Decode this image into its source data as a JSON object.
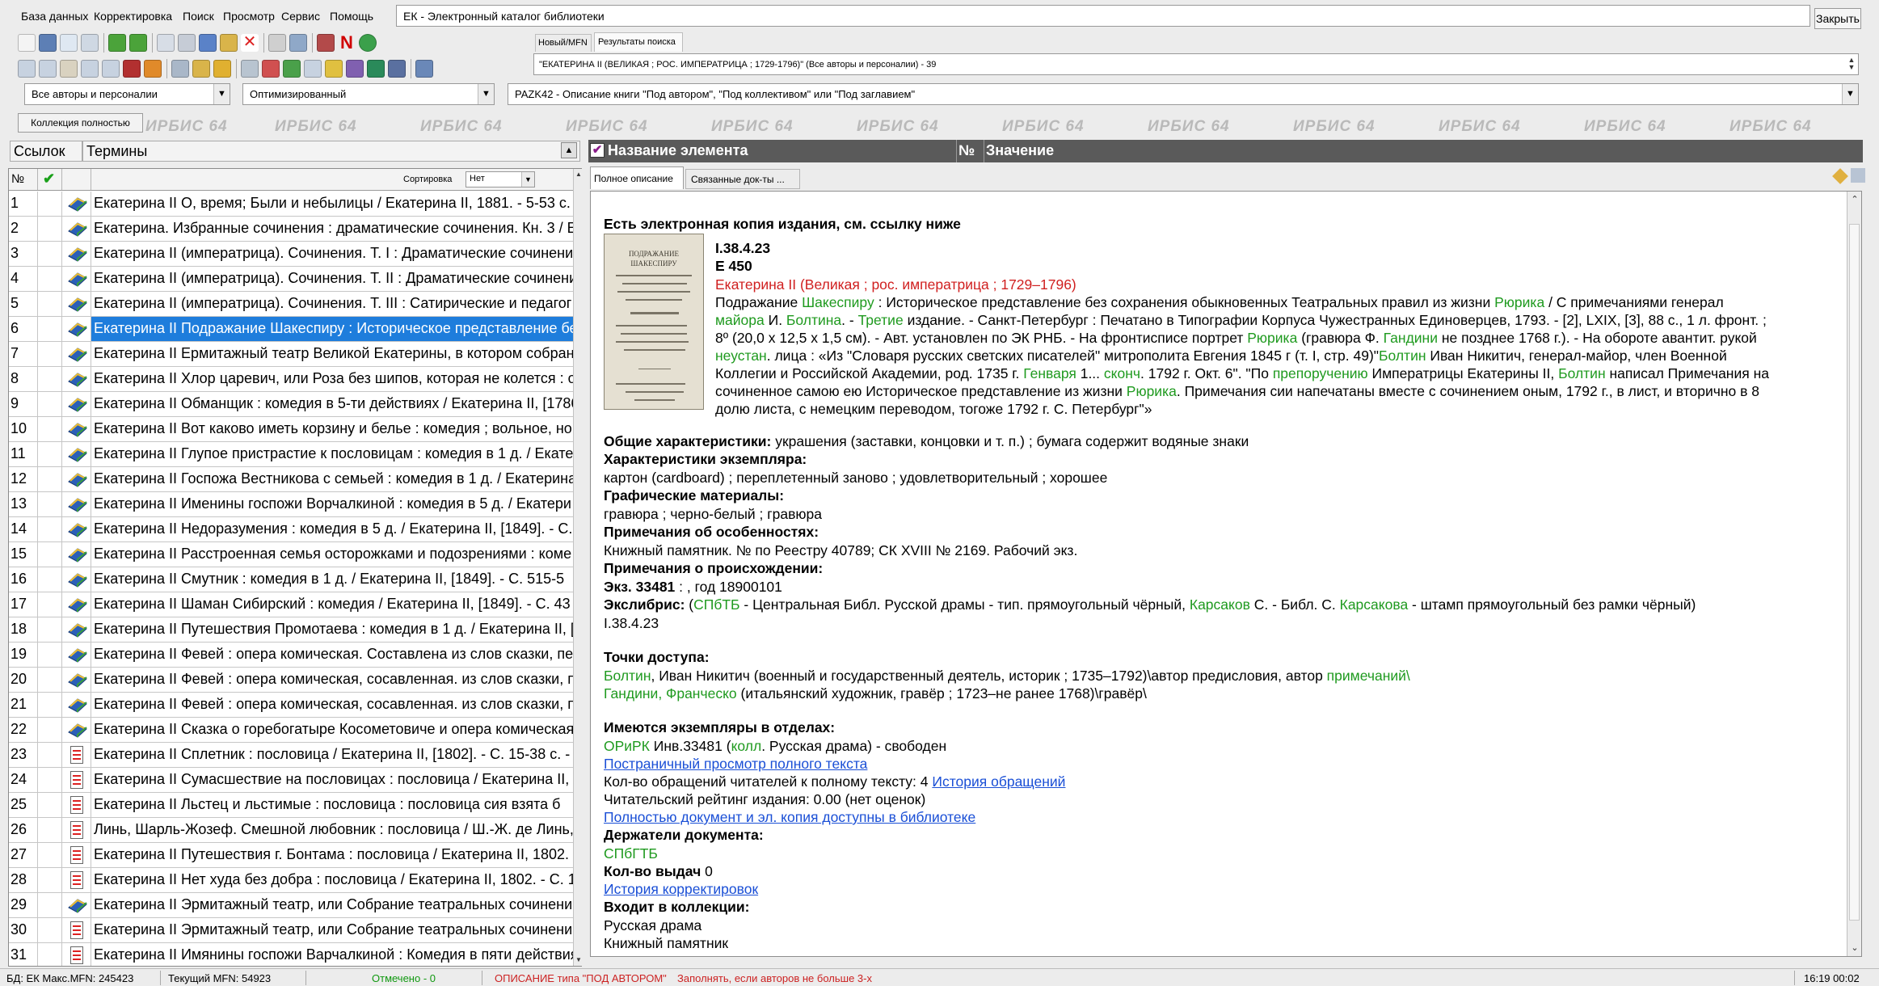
{
  "menu": [
    "База данных",
    "Корректировка",
    "Поиск",
    "Просмотр",
    "Сервис",
    "Помощь"
  ],
  "window_title": "ЕК - Электронный каталог библиотеки",
  "close_label": "Закрыть",
  "tabs": {
    "new_mfn": "Новый/MFN",
    "results": "Результаты поиска"
  },
  "query": "\"ЕКАТЕРИНА II (ВЕЛИКАЯ ; РОС. ИМПЕРАТРИЦА ; 1729-1796)\" (Все авторы и персоналии) - 39",
  "combos": {
    "authors": "Все авторы и персоналии",
    "optimized": "Оптимизированный",
    "worksheet": "PAZK42 - Описание книги \"Под автором\", \"Под коллективом\" или \"Под заглавием\""
  },
  "collection_button": "Коллекция полностью",
  "watermark": "ИРБИС 64",
  "left_panel": {
    "col_ssylok": "Ссылок",
    "col_terms": "Термины",
    "col_no": "№",
    "sort_label": "Сортировка",
    "sort_value": "Нет"
  },
  "rows": [
    {
      "n": "1",
      "icon": "book",
      "text": "Екатерина II О, время; Были и небылицы / Екатерина II, 1881. - 5-53 с."
    },
    {
      "n": "2",
      "icon": "book",
      "text": "Екатерина. Избранные сочинения : драматические сочинения. Кн. 3 / Ек"
    },
    {
      "n": "3",
      "icon": "book",
      "text": "Екатерина II (императрица). Сочинения. Т. I : Драматические сочинения"
    },
    {
      "n": "4",
      "icon": "book",
      "text": "Екатерина II (императрица). Сочинения. Т. II : Драматические сочинения"
    },
    {
      "n": "5",
      "icon": "book",
      "text": "Екатерина II (императрица). Сочинения. Т. III : Сатирические и педагог"
    },
    {
      "n": "6",
      "icon": "book",
      "text": "Екатерина II Подражание Шакеспиру : Историческое представление без"
    },
    {
      "n": "7",
      "icon": "book",
      "text": "Екатерина II Ермитажный театр Великой Екатерины, в котором собраны"
    },
    {
      "n": "8",
      "icon": "book",
      "text": "Екатерина II Хлор царевич, или Роза без шипов, которая не колется : о"
    },
    {
      "n": "9",
      "icon": "book",
      "text": "Екатерина II Обманщик : комедия в 5-ти действиях / Екатерина II, [1786"
    },
    {
      "n": "10",
      "icon": "book",
      "text": "Екатерина II Вот каково иметь корзину и белье : комедия ; вольное, но"
    },
    {
      "n": "11",
      "icon": "book",
      "text": "Екатерина II Глупое пристрастие к пословицам : комедия в 1 д. / Екатер"
    },
    {
      "n": "12",
      "icon": "book",
      "text": "Екатерина II Госпожа Вестникова с семьей : комедия в 1 д. / Екатерина"
    },
    {
      "n": "13",
      "icon": "book",
      "text": "Екатерина II Именины госпожи Ворчалкиной : комедия в 5 д. / Екатери"
    },
    {
      "n": "14",
      "icon": "book",
      "text": "Екатерина II Недоразумения : комедия в 5 д. / Екатерина II, [1849]. - С."
    },
    {
      "n": "15",
      "icon": "book",
      "text": "Екатерина II Расстроенная семья осторожками и подозрениями : коме"
    },
    {
      "n": "16",
      "icon": "book",
      "text": "Екатерина II Смутник : комедия в 1 д. / Екатерина II, [1849]. - С. 515-5"
    },
    {
      "n": "17",
      "icon": "book",
      "text": "Екатерина II Шаман Сибирский : комедия / Екатерина II, [1849]. - С. 43"
    },
    {
      "n": "18",
      "icon": "book",
      "text": "Екатерина II Путешествия Промотаева : комедия в 1 д. / Екатерина II, ["
    },
    {
      "n": "19",
      "icon": "book",
      "text": "Екатерина II Февей : опера комическая. Составлена из слов сказки, пес"
    },
    {
      "n": "20",
      "icon": "book",
      "text": "Екатерина II Февей : опера комическая, сосавленная. из слов сказки, пе"
    },
    {
      "n": "21",
      "icon": "book",
      "text": "Екатерина II Февей : опера комическая, сосавленная. из слов сказки, пе"
    },
    {
      "n": "22",
      "icon": "book",
      "text": "Екатерина II Сказка о горебогатыре Косометовиче и опера комическая"
    },
    {
      "n": "23",
      "icon": "doc",
      "text": "Екатерина II Сплетник : пословица / Екатерина II, [1802]. - С. 15-38 с. -"
    },
    {
      "n": "24",
      "icon": "doc",
      "text": "Екатерина II Сумасшествие на пословицах : пословица / Екатерина II, ["
    },
    {
      "n": "25",
      "icon": "doc",
      "text": "Екатерина II Льстец и льстимые : пословица : пословица сия взята б"
    },
    {
      "n": "26",
      "icon": "doc",
      "text": "Линь, Шарль-Жозеф. Смешной любовник : пословица / Ш.-Ж. де Линь,"
    },
    {
      "n": "27",
      "icon": "doc",
      "text": "Екатерина II Путешествия г. Бонтама : пословица / Екатерина II, 1802. -"
    },
    {
      "n": "28",
      "icon": "doc",
      "text": "Екатерина II Нет худа без добра : пословица / Екатерина II, 1802. - С. 1"
    },
    {
      "n": "29",
      "icon": "book",
      "text": "Екатерина II Эрмитажный театр, или Собрание театральных сочинений"
    },
    {
      "n": "30",
      "icon": "doc",
      "text": "Екатерина II Эрмитажный театр, или Собрание театральных сочинений"
    },
    {
      "n": "31",
      "icon": "doc",
      "text": "Екатерина II Имянины госпожи Варчалкиной : Комедия в пяти действия"
    }
  ],
  "selected_row": 6,
  "right_panel": {
    "col_name": "Название элемента",
    "col_no": "№",
    "col_value": "Значение",
    "tab_full": "Полное описание",
    "tab_linked": "Связанные док-ты ..."
  },
  "record": {
    "e_copy": "Есть электронная копия издания, см. ссылку ниже",
    "cover_title": "ПОДРАЖАНИЕ ШАКЕСПИРУ",
    "shelf": "I.38.4.23",
    "author_sign": "Е 450",
    "author": "Екатерина II (Великая ; рос. императрица ; 1729–1796)",
    "d1": [
      {
        "t": "Подражание ",
        "c": ""
      },
      {
        "t": "Шакеспиру",
        "c": "grn"
      },
      {
        "t": " : Историческое представление без сохранения обыкновенных Театральных правил из жизни ",
        "c": ""
      },
      {
        "t": "Рюрика",
        "c": "grn"
      },
      {
        "t": " / С примечаниями генерал",
        "c": ""
      }
    ],
    "d2": [
      {
        "t": "майора",
        "c": "grn"
      },
      {
        "t": " И. ",
        "c": ""
      },
      {
        "t": "Болтина",
        "c": "grn"
      },
      {
        "t": ". - ",
        "c": ""
      },
      {
        "t": "Третие",
        "c": "grn"
      },
      {
        "t": " издание. - Санкт-Петербург : Печатано в Типографии Корпуса Чужестранных Единоверцев, 1793. - [2], LXIX, [3], 88 с., 1 л. фронт. ;",
        "c": ""
      }
    ],
    "d3": [
      {
        "t": "8º (20,0 х 12,5 х 1,5 см). - Авт. установлен по ЭК РНБ. - На фронтисписе портрет ",
        "c": ""
      },
      {
        "t": "Рюрика",
        "c": "grn"
      },
      {
        "t": " (гравюра Ф. ",
        "c": ""
      },
      {
        "t": "Гандини",
        "c": "grn"
      },
      {
        "t": " не позднее 1768 г.). - На обороте авантит. рукой",
        "c": ""
      }
    ],
    "d4": [
      {
        "t": "неустан",
        "c": "grn"
      },
      {
        "t": ". лица : «Из \"Словаря русских светских писателей\" митрополита Евгения 1845 г (т. I, стр. 49)\"",
        "c": ""
      },
      {
        "t": "Болтин",
        "c": "grn"
      },
      {
        "t": " Иван Никитич, генерал-майор, член Военной",
        "c": ""
      }
    ],
    "d5": [
      {
        "t": "Коллегии и Российской Академии, род. 1735 г. ",
        "c": ""
      },
      {
        "t": "Генваря",
        "c": "grn"
      },
      {
        "t": " 1... ",
        "c": ""
      },
      {
        "t": "сконч",
        "c": "grn"
      },
      {
        "t": ". 1792 г. Окт. 6\". \"По ",
        "c": ""
      },
      {
        "t": "препоручению",
        "c": "grn"
      },
      {
        "t": " Императрицы Екатерины II, ",
        "c": ""
      },
      {
        "t": "Болтин",
        "c": "grn"
      },
      {
        "t": " написал Примечания на",
        "c": ""
      }
    ],
    "d6": [
      {
        "t": "сочиненное самою ею Историческое представление из жизни ",
        "c": ""
      },
      {
        "t": "Рюрика",
        "c": "grn"
      },
      {
        "t": ". Примечания сии напечатаны вместе с сочинением оным, 1792 г., в лист, и вторично в 8",
        "c": ""
      }
    ],
    "d7": [
      {
        "t": "долю листа, с немецким переводом, тогоже 1792 г. С. Петербург\"»",
        "c": ""
      }
    ],
    "general_label": "Общие характеристики:",
    "general_value": " украшения (заставки, концовки и т. п.) ; бумага содержит водяные знаки",
    "copy_char_label": "Характеристики экземпляра:",
    "copy_char_value": "картон (cardboard) ; переплетенный заново ; удовлетворительный ; хорошее",
    "graphic_label": "Графические материалы:",
    "graphic_value": "гравюра ; черно-белый ; гравюра",
    "features_label": "Примечания об особенностях:",
    "features_value": "Книжный памятник. № по Реестру 40789; СК XVIII № 2169. Рабочий экз.",
    "provenance_label": "Примечания о происхождении:",
    "copy_no_label": "Экз. 33481",
    "copy_no_value": " : , год 18900101",
    "exlibris": [
      {
        "t": "Экслибрис:",
        "c": "b"
      },
      {
        "t": " (",
        "c": ""
      },
      {
        "t": "СПбТБ",
        "c": "grn"
      },
      {
        "t": " - Центральная Библ. Русской драмы - тип. прямоугольный чёрный, ",
        "c": ""
      },
      {
        "t": "Карсаков",
        "c": "grn"
      },
      {
        "t": " С. - Библ. С. ",
        "c": ""
      },
      {
        "t": "Карсакова",
        "c": "grn"
      },
      {
        "t": " - штамп прямоугольный без рамки чёрный)",
        "c": ""
      }
    ],
    "shelf2": "I.38.4.23",
    "access_label": "Точки доступа:",
    "access1": [
      {
        "t": "Болтин",
        "c": "grn"
      },
      {
        "t": ", Иван Никитич (военный и государственный деятель, историк ; 1735–1792)\\автор предисловия, автор ",
        "c": ""
      },
      {
        "t": "примечаний\\",
        "c": "grn"
      }
    ],
    "access2": [
      {
        "t": "Гандини, Франческо",
        "c": "grn"
      },
      {
        "t": " (итальянский художник, гравёр ; 1723–не ранее 1768)\\гравёр\\",
        "c": ""
      }
    ],
    "depts_label": "Имеются экземпляры в отделах:",
    "dept": [
      {
        "t": "ОРиРК",
        "c": "grn"
      },
      {
        "t": " Инв.33481 (",
        "c": ""
      },
      {
        "t": "колл",
        "c": "grn"
      },
      {
        "t": ". Русская драма) - свободен",
        "c": ""
      }
    ],
    "page_view_link": "Постраничный просмотр полного текста",
    "requests_text": "Кол-во обращений читателей к полному тексту: 4 ",
    "requests_link": "История обращений",
    "rating": "Читательский рейтинг издания: 0.00 (нет оценок)",
    "full_access_link": "Полностью документ и эл. копия доступны в библиотеке",
    "holders_label": "Держатели документа:",
    "holder": "СПбГТБ",
    "loans_label": "Кол-во выдач",
    "loans_value": " 0",
    "history_link": "История корректировок",
    "collections_label": "Входит в коллекции:",
    "coll1": "Русская драма",
    "coll2": "Книжный памятник"
  },
  "status": {
    "db": "БД: ЕК Макс.MFN: 245423",
    "current": "Текущий MFN: 54923",
    "marked": "Отмечено - 0",
    "worksheet": "ОПИСАНИЕ типа \"ПОД АВТОРОМ\"",
    "hint": "Заполнять, если авторов не больше 3-х",
    "time": "16:19 00:02"
  },
  "colors": {
    "selection": "#1e7ddc",
    "green_link": "#1f9a1f",
    "red_author": "#d02020",
    "blue_link": "#1a4fd6",
    "status_red": "#cc2222",
    "status_green": "#119911"
  }
}
